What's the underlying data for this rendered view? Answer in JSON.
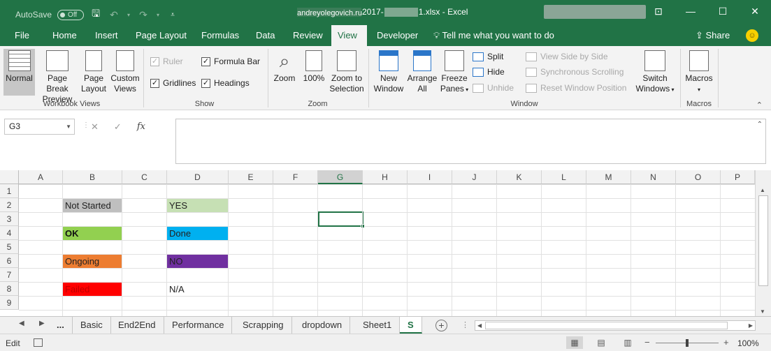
{
  "titlebar": {
    "autosave_label": "AutoSave",
    "autosave_state": "Off",
    "filename_prefix": "andreyolegovich.ru",
    "filename_mid": "2017-",
    "filename_suffix": "1.xlsx",
    "app_sep": " - ",
    "app_name": "Excel"
  },
  "tabs": [
    "File",
    "Home",
    "Insert",
    "Page Layout",
    "Formulas",
    "Data",
    "Review",
    "View",
    "Developer"
  ],
  "active_tab": "View",
  "tell_me": "Tell me what you want to do",
  "share_label": "Share",
  "ribbon": {
    "workbook_views": {
      "label": "Workbook Views",
      "normal": "Normal",
      "page_break_1": "Page Break",
      "page_break_2": "Preview",
      "page_layout_1": "Page",
      "page_layout_2": "Layout",
      "custom_1": "Custom",
      "custom_2": "Views"
    },
    "show": {
      "label": "Show",
      "ruler": "Ruler",
      "gridlines": "Gridlines",
      "formula_bar": "Formula Bar",
      "headings": "Headings"
    },
    "zoom": {
      "label": "Zoom",
      "zoom": "Zoom",
      "hundred": "100%",
      "sel_1": "Zoom to",
      "sel_2": "Selection"
    },
    "window": {
      "label": "Window",
      "new_1": "New",
      "new_2": "Window",
      "arrange_1": "Arrange",
      "arrange_2": "All",
      "freeze_1": "Freeze",
      "freeze_2": "Panes",
      "split": "Split",
      "hide": "Hide",
      "unhide": "Unhide",
      "side_by_side": "View Side by Side",
      "sync_scroll": "Synchronous Scrolling",
      "reset_pos": "Reset Window Position",
      "switch_1": "Switch",
      "switch_2": "Windows"
    },
    "macros": {
      "label": "Macros",
      "macros": "Macros"
    }
  },
  "formula_bar": {
    "name_box": "G3",
    "cancel": "✕",
    "enter": "✓",
    "fx": "fx",
    "value": ""
  },
  "columns": [
    "A",
    "B",
    "C",
    "D",
    "E",
    "F",
    "G",
    "H",
    "I",
    "J",
    "K",
    "L",
    "M",
    "N",
    "O",
    "P"
  ],
  "rows": [
    "1",
    "2",
    "3",
    "4",
    "5",
    "6",
    "7",
    "8",
    "9"
  ],
  "selected_column": "G",
  "cells": [
    {
      "ref": "B2",
      "text": "Not Started",
      "bg": "#bfbfbf",
      "color": "#222222",
      "bold": false
    },
    {
      "ref": "D2",
      "text": "YES",
      "bg": "#c6e0b4",
      "color": "#222222",
      "bold": false
    },
    {
      "ref": "B4",
      "text": "OK",
      "bg": "#92d050",
      "color": "#111111",
      "bold": true
    },
    {
      "ref": "D4",
      "text": "Done",
      "bg": "#00b0f0",
      "color": "#222222",
      "bold": false
    },
    {
      "ref": "B6",
      "text": "Ongoing",
      "bg": "#ed7d31",
      "color": "#222222",
      "bold": false
    },
    {
      "ref": "D6",
      "text": "NO",
      "bg": "#7030a0",
      "color": "#222222",
      "bold": false
    },
    {
      "ref": "B8",
      "text": "Failed",
      "bg": "#ff0000",
      "color": "#c00000",
      "bold": false
    },
    {
      "ref": "D8",
      "text": "N/A",
      "bg": "",
      "color": "#222222",
      "bold": false
    }
  ],
  "sheet_tabs": {
    "ellipsis": "...",
    "tabs": [
      "Basic",
      "End2End",
      "Performance",
      "Scrapping",
      "dropdown",
      "Sheet1",
      "S"
    ],
    "active": "S"
  },
  "status": {
    "mode": "Edit",
    "zoom": "100%",
    "zoom_level_pct": 50
  },
  "colors": {
    "accent": "#217346"
  }
}
